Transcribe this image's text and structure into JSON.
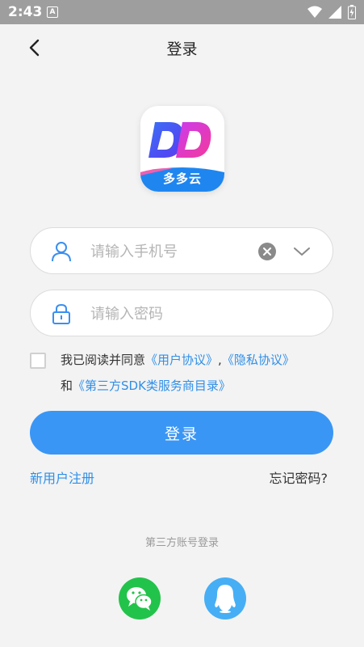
{
  "status_bar": {
    "time": "2:43",
    "notification_letter": "A"
  },
  "header": {
    "title": "登录"
  },
  "logo": {
    "brand_text": "多多云"
  },
  "phone_field": {
    "placeholder": "请输入手机号",
    "value": ""
  },
  "password_field": {
    "placeholder": "请输入密码",
    "value": ""
  },
  "agreement": {
    "checked": false,
    "prefix": "我已阅读并同意",
    "user_agreement": "《用户协议》",
    "separator": ",",
    "privacy_agreement": "《隐私协议》",
    "and": "和",
    "sdk_list": "《第三方SDK类服务商目录》"
  },
  "actions": {
    "login_label": "登录",
    "register_label": "新用户注册",
    "forgot_label": "忘记密码?"
  },
  "third_party": {
    "label": "第三方账号登录"
  },
  "colors": {
    "primary": "#3a96f5",
    "link": "#2f8fe8",
    "wechat": "#22c34a",
    "qq": "#46aef5"
  }
}
